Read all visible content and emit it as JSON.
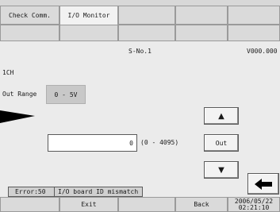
{
  "tabs": {
    "check_comm": "Check Comm.",
    "io_monitor": "I/O Monitor"
  },
  "header": {
    "slot_label": "S-No.1",
    "version": "V000.000"
  },
  "channel": "1CH",
  "out_range": {
    "label": "Out Range",
    "value": "0 - 5V"
  },
  "output": {
    "value": "0",
    "range_hint": "(0 - 4095)"
  },
  "buttons": {
    "up": "▲",
    "out": "Out",
    "down": "▼",
    "back_arrow": "🡄"
  },
  "status": {
    "error_code": "Error:50",
    "message": "I/O board ID mismatch"
  },
  "footer": {
    "exit": "Exit",
    "back": "Back",
    "date": "2006/05/22",
    "time": "02:21:10"
  },
  "pointer": {
    "icon": "pointer-arrow-icon"
  }
}
